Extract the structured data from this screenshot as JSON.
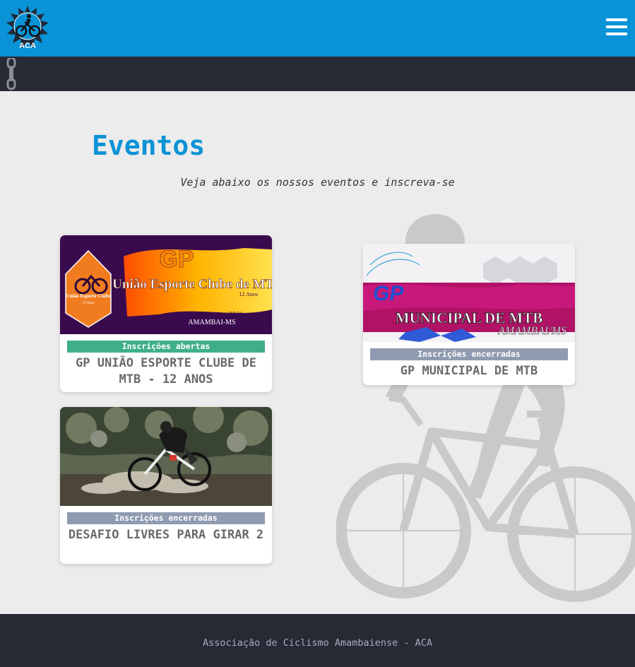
{
  "header": {
    "logo_text": "ACA",
    "menu_icon": "hamburger-menu-icon",
    "brand_color": "#0a93d6"
  },
  "page": {
    "title": "Eventos",
    "subtitle": "Veja abaixo os nossos eventos e inscreva-se"
  },
  "events": [
    {
      "status": "Inscrições abertas",
      "name": "GP UNIÃO ESPORTE CLUBE DE MTB - 12 ANOS",
      "image": {
        "title_small": "GP",
        "title": "União Esporte Clube de MTB",
        "subtitle": "12 Anos",
        "badge": "União Esporte Clube",
        "date": "19 de Dezembro 2021",
        "place": "AMAMBAI-MS"
      },
      "status_color": "#3faf8a"
    },
    {
      "status": "Inscrições encerradas",
      "name": "GP MUNICIPAL DE MTB",
      "image": {
        "title_small": "GP",
        "title": "MUNICIPAL DE MTB",
        "place": "AMAMBAI/MS"
      },
      "status_color": "#8f9bb0"
    },
    {
      "status": "Inscrições encerradas",
      "name": "DESAFIO LIVRES PARA GIRAR 2",
      "status_color": "#8f9bb0"
    }
  ],
  "footer": {
    "text": "Associação de Ciclismo Amambaiense - ACA"
  }
}
